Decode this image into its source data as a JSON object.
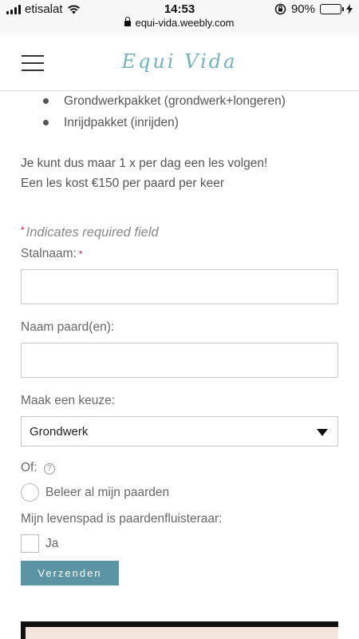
{
  "status_bar": {
    "carrier": "etisalat",
    "time": "14:53",
    "battery_percent": "90%",
    "battery_level": 0.9,
    "url": "equi-vida.weebly.com"
  },
  "header": {
    "brand": "Equi Vida"
  },
  "content": {
    "bullets": [
      "Grondwerkpakket (grondwerk+longeren)",
      "Inrijdpakket (inrijden)"
    ],
    "info_lines": [
      "Je kunt dus maar 1 x per dag een les volgen!",
      "Een les kost €150 per paard per keer"
    ]
  },
  "form": {
    "required_star": "*",
    "required_note": "Indicates required field",
    "stalnaam_label": "Stalnaam:",
    "stalnaam_value": "",
    "naam_paard_label": "Naam paard(en):",
    "naam_paard_value": "",
    "keuze_label": "Maak een keuze:",
    "keuze_selected": "Grondwerk",
    "of_label": "Of:",
    "help_glyph": "?",
    "radio_option": "Beleer al mijn paarden",
    "levenspad_label": "Mijn levenspad is paardenfluisteraar:",
    "checkbox_option": "Ja",
    "submit_label": "Verzenden"
  },
  "colors": {
    "brand": "#74b1b8",
    "button": "#5b95a3",
    "required": "#dd1144"
  }
}
